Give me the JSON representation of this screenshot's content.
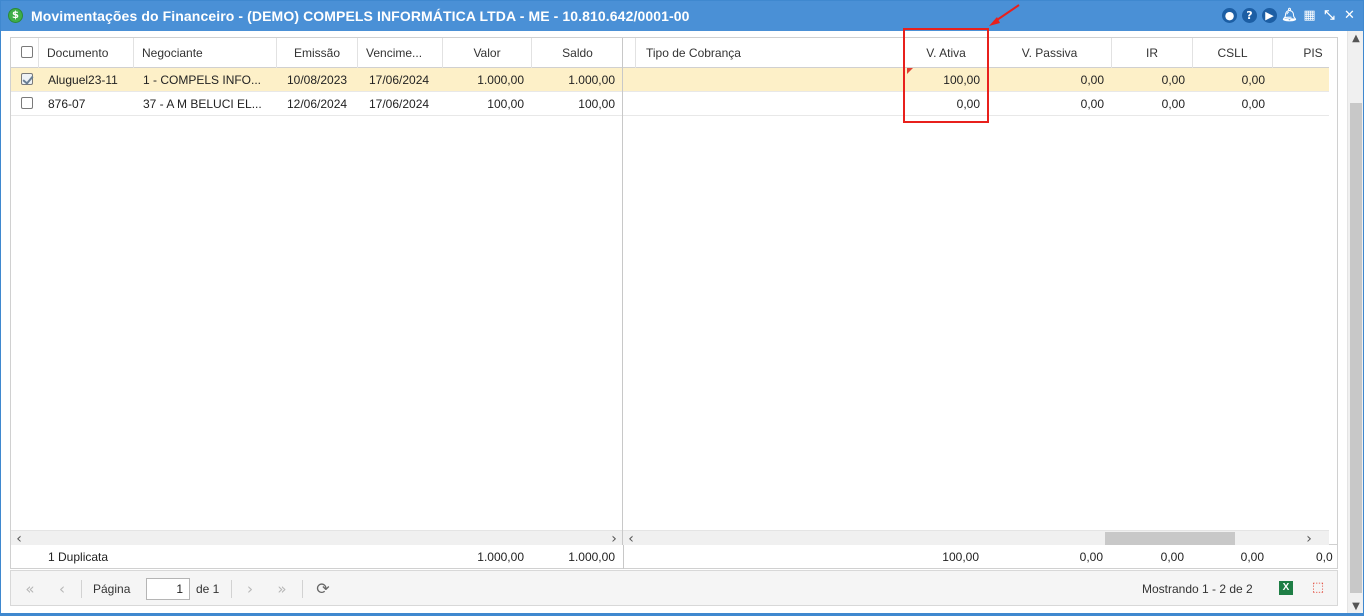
{
  "window": {
    "title": "Movimentações do Financeiro - (DEMO) COMPELS INFORMÁTICA LTDA - ME - 10.810.642/0001-00",
    "app_icon": "$",
    "icons": [
      "eye-icon",
      "help-icon",
      "play-icon",
      "bell-icon",
      "calendar-icon",
      "collapse-icon",
      "close-icon"
    ]
  },
  "left_columns": [
    "Documento",
    "Negociante",
    "Emissão",
    "Vencime...",
    "Valor",
    "Saldo"
  ],
  "right_columns": [
    "Tipo de Cobrança",
    "V. Ativa",
    "V. Passiva",
    "IR",
    "CSLL",
    "PIS"
  ],
  "rows": [
    {
      "selected": true,
      "documento": "Aluguel23-11",
      "negociante": "1 - COMPELS INFO...",
      "emissao": "10/08/2023",
      "vencimento": "17/06/2024",
      "valor": "1.000,00",
      "saldo": "1.000,00",
      "tipo_cobranca": "",
      "v_ativa": "100,00",
      "v_passiva": "0,00",
      "ir": "0,00",
      "csll": "0,00"
    },
    {
      "selected": false,
      "documento": "876-07",
      "negociante": "37 - A M BELUCI EL...",
      "emissao": "12/06/2024",
      "vencimento": "17/06/2024",
      "valor": "100,00",
      "saldo": "100,00",
      "tipo_cobranca": "",
      "v_ativa": "0,00",
      "v_passiva": "0,00",
      "ir": "0,00",
      "csll": "0,00"
    }
  ],
  "summary": {
    "label": "1 Duplicata",
    "valor": "1.000,00",
    "saldo": "1.000,00",
    "v_ativa": "100,00",
    "v_passiva": "0,00",
    "ir": "0,00",
    "csll": "0,00",
    "pis": "0,0"
  },
  "pager": {
    "page_label": "Página",
    "page_value": "1",
    "of_label": "de 1",
    "showing": "Mostrando 1 - 2 de 2",
    "excel_label": "X"
  },
  "colors": {
    "titlebar": "#4a90d6",
    "selected_row": "#fdf0c8",
    "highlight": "#e8201c"
  }
}
